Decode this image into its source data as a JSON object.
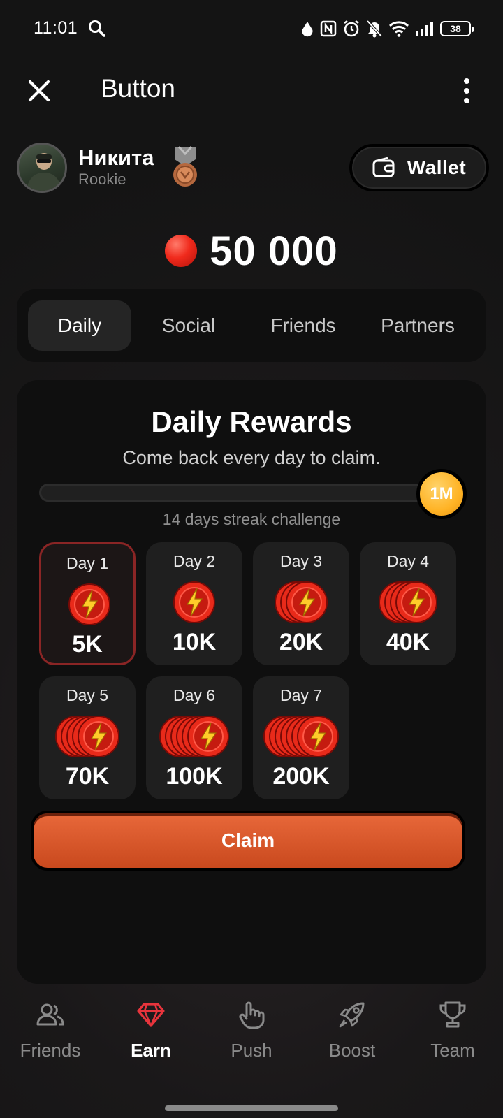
{
  "status_bar": {
    "time": "11:01",
    "battery": "38"
  },
  "header": {
    "title": "Button"
  },
  "profile": {
    "name": "Никита",
    "rank": "Rookie"
  },
  "wallet": {
    "label": "Wallet"
  },
  "balance": {
    "value": "50 000"
  },
  "tabs": [
    {
      "label": "Daily",
      "active": true
    },
    {
      "label": "Social",
      "active": false
    },
    {
      "label": "Friends",
      "active": false
    },
    {
      "label": "Partners",
      "active": false
    }
  ],
  "rewards": {
    "title": "Daily Rewards",
    "subtitle": "Come back every day to claim.",
    "milestone": "1M",
    "streak_label": "14 days streak challenge",
    "progress": 0,
    "days": [
      {
        "label": "Day 1",
        "amount": "5K",
        "coins": 1,
        "current": true
      },
      {
        "label": "Day 2",
        "amount": "10K",
        "coins": 1,
        "current": false
      },
      {
        "label": "Day 3",
        "amount": "20K",
        "coins": 3,
        "current": false
      },
      {
        "label": "Day 4",
        "amount": "40K",
        "coins": 4,
        "current": false
      },
      {
        "label": "Day 5",
        "amount": "70K",
        "coins": 5,
        "current": false
      },
      {
        "label": "Day 6",
        "amount": "100K",
        "coins": 6,
        "current": false
      },
      {
        "label": "Day 7",
        "amount": "200K",
        "coins": 7,
        "current": false
      }
    ],
    "claim_label": "Claim"
  },
  "nav": [
    {
      "label": "Friends",
      "icon": "friends-icon",
      "active": false
    },
    {
      "label": "Earn",
      "icon": "gem-icon",
      "active": true
    },
    {
      "label": "Push",
      "icon": "hand-pointer-icon",
      "active": false
    },
    {
      "label": "Boost",
      "icon": "rocket-icon",
      "active": false
    },
    {
      "label": "Team",
      "icon": "trophy-icon",
      "active": false
    }
  ],
  "colors": {
    "background": "#151515",
    "panel": "#0f0f0f",
    "card": "#1f1f1f",
    "accent_claim": "#d9552a",
    "coin_red": "#e82a1a",
    "milestone_gold": "#ffb325",
    "active_nav": "#e8343c"
  }
}
